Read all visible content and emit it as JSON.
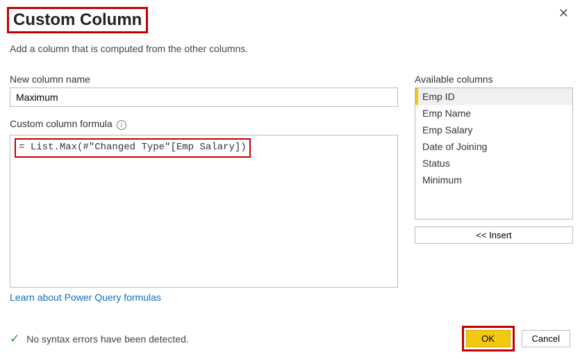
{
  "header": {
    "title": "Custom Column",
    "subtitle": "Add a column that is computed from the other columns."
  },
  "newColumn": {
    "label": "New column name",
    "value": "Maximum"
  },
  "formula": {
    "label": "Custom column formula",
    "prefix": "= ",
    "value": "List.Max(#\"Changed Type\"[Emp Salary])"
  },
  "availableColumns": {
    "label": "Available columns",
    "items": [
      {
        "name": "Emp ID",
        "selected": true
      },
      {
        "name": "Emp Name",
        "selected": false
      },
      {
        "name": "Emp Salary",
        "selected": false
      },
      {
        "name": "Date of Joining",
        "selected": false
      },
      {
        "name": "Status",
        "selected": false
      },
      {
        "name": "Minimum",
        "selected": false
      }
    ],
    "insertLabel": "<< Insert"
  },
  "link": {
    "text": "Learn about Power Query formulas"
  },
  "status": {
    "text": "No syntax errors have been detected."
  },
  "buttons": {
    "ok": "OK",
    "cancel": "Cancel"
  }
}
